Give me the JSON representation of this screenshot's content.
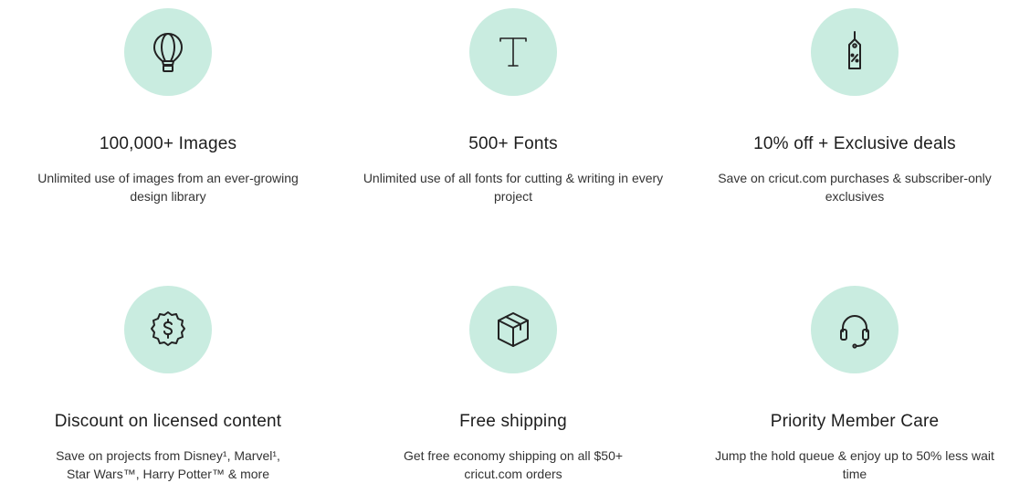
{
  "accent_color": "#c9ece0",
  "features": [
    {
      "icon": "hot-air-balloon-icon",
      "title": "100,000+ Images",
      "description": "Unlimited use of images from an ever-growing design library"
    },
    {
      "icon": "font-t-icon",
      "title": "500+ Fonts",
      "description": "Unlimited use of all fonts for cutting & writing in every project"
    },
    {
      "icon": "price-tag-icon",
      "title": "10% off + Exclusive deals",
      "description": "Save on cricut.com purchases & subscriber-only exclusives"
    },
    {
      "icon": "dollar-badge-icon",
      "title": "Discount on licensed content",
      "description": "Save on projects from Disney¹, Marvel¹, Star Wars™, Harry Potter™ & more"
    },
    {
      "icon": "box-icon",
      "title": "Free shipping",
      "description": "Get free economy shipping on all $50+ cricut.com orders"
    },
    {
      "icon": "headset-icon",
      "title": "Priority Member Care",
      "description": "Jump the hold queue & enjoy up to 50% less wait time"
    }
  ]
}
